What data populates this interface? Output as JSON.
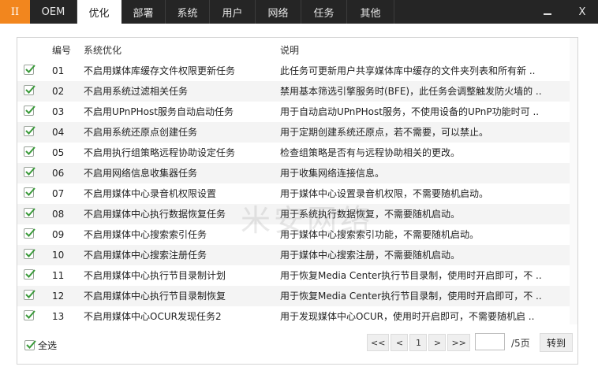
{
  "nav": {
    "logo": "II",
    "tabs": [
      "OEM",
      "优化",
      "部署",
      "系统",
      "用户",
      "网络",
      "任务",
      "其他"
    ],
    "active_tab": "优化",
    "close": "X"
  },
  "table": {
    "headers": {
      "num": "编号",
      "name": "系统优化",
      "desc": "说明"
    },
    "rows": [
      {
        "checked": true,
        "num": "01",
        "name": "不启用媒体库缓存文件权限更新任务",
        "desc": "此任务可更新用户共享媒体库中缓存的文件夹列表和所有新 .."
      },
      {
        "checked": true,
        "num": "02",
        "name": "不启用系统过滤相关任务",
        "desc": "禁用基本筛选引擎服务时(BFE)，此任务会调整触发防火墙的 .."
      },
      {
        "checked": true,
        "num": "03",
        "name": "不启用UPnPHost服务自动启动任务",
        "desc": "用于自动启动UPnPHost服务，不使用设备的UPnP功能时可 .."
      },
      {
        "checked": true,
        "num": "04",
        "name": "不启用系统还原点创建任务",
        "desc": "用于定期创建系统还原点，若不需要，可以禁止。"
      },
      {
        "checked": true,
        "num": "05",
        "name": "不启用执行组策略远程协助设定任务",
        "desc": "检查组策略是否有与远程协助相关的更改。"
      },
      {
        "checked": true,
        "num": "06",
        "name": "不启用网络信息收集器任务",
        "desc": "用于收集网络连接信息。"
      },
      {
        "checked": true,
        "num": "07",
        "name": "不启用媒体中心录音机权限设置",
        "desc": "用于媒体中心设置录音机权限，不需要随机启动。"
      },
      {
        "checked": true,
        "num": "08",
        "name": "不启用媒体中心执行数据恢复任务",
        "desc": "用于系统执行数据恢复，不需要随机启动。"
      },
      {
        "checked": true,
        "num": "09",
        "name": "不启用媒体中心搜索索引任务",
        "desc": "用于媒体中心搜索索引功能，不需要随机启动。"
      },
      {
        "checked": true,
        "num": "10",
        "name": "不启用媒体中心搜索注册任务",
        "desc": "用于媒体中心搜索注册，不需要随机启动。"
      },
      {
        "checked": true,
        "num": "11",
        "name": "不启用媒体中心执行节目录制计划",
        "desc": "用于恢复Media Center执行节目录制，使用时开启即可，不 .."
      },
      {
        "checked": true,
        "num": "12",
        "name": "不启用媒体中心执行节目录制恢复",
        "desc": "用于恢复Media Center执行节目录制，使用时开启即可，不 .."
      },
      {
        "checked": true,
        "num": "13",
        "name": "不启用媒体中心OCUR发现任务2",
        "desc": "用于发现媒体中心OCUR，使用时开启即可，不需要随机启 .."
      }
    ]
  },
  "watermark": "米安网络",
  "footer": {
    "select_all": "全选",
    "select_all_checked": true,
    "pager": {
      "first": "<<",
      "prev": "<",
      "current": "1",
      "next": ">",
      "last": ">>"
    },
    "page_input_value": "",
    "page_total": "/5页",
    "goto": "转到"
  },
  "colors": {
    "topbar": "#252525",
    "logo": "#f2861e",
    "check": "#3a9a3a",
    "alt_row": "#f4f4f4"
  }
}
